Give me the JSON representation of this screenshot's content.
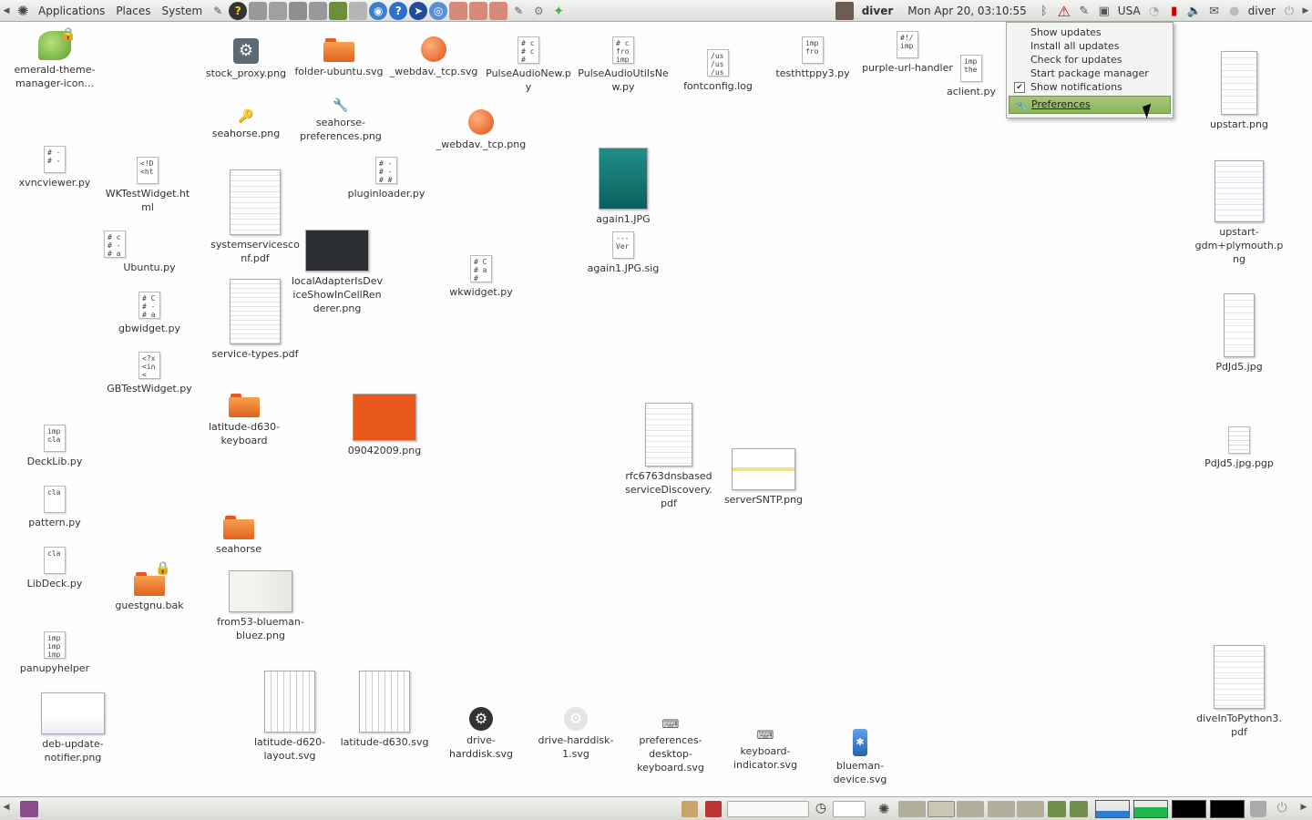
{
  "top_panel": {
    "menu": [
      "Applications",
      "Places",
      "System"
    ],
    "user": "diver",
    "clock": "Mon Apr 20, 03:10:55",
    "keyboard_layout": "USA",
    "chat_user": "diver"
  },
  "update_menu": {
    "items": [
      "Show updates",
      "Install all updates",
      "Check for updates",
      "Start package manager"
    ],
    "check_item": "Show notifications",
    "check_mark": "✔",
    "selected": "Preferences"
  },
  "desktop_icons": [
    {
      "label": "emerald-theme-manager-icon...",
      "glyph": "🍃"
    },
    {
      "label": "xvncviewer.py",
      "glyph": "# -\n# -"
    },
    {
      "label": "WKTestWidget.html",
      "glyph": "<!D\n<ht"
    },
    {
      "label": "Ubuntu.py",
      "glyph": "# c\n# -\n# a"
    },
    {
      "label": "gbwidget.py",
      "glyph": "# C\n# -\n# a"
    },
    {
      "label": "GBTestWidget.py",
      "glyph": "<?x\n<in\n<"
    },
    {
      "label": "DeckLib.py",
      "glyph": "imp\ncla"
    },
    {
      "label": "pattern.py",
      "glyph": "cla"
    },
    {
      "label": "LibDeck.py",
      "glyph": "cla"
    },
    {
      "label": "guestgnu.bak",
      "glyph": ""
    },
    {
      "label": "panupyhelper",
      "glyph": "imp\nimp\nimp"
    },
    {
      "label": "deb-update-notifier.png",
      "glyph": ""
    },
    {
      "label": "stock_proxy.png",
      "glyph": "⚙"
    },
    {
      "label": "seahorse.png",
      "glyph": "🔑"
    },
    {
      "label": "systemservicesconf.pdf",
      "glyph": ""
    },
    {
      "label": "service-types.pdf",
      "glyph": ""
    },
    {
      "label": "latitude-d630-keyboard",
      "glyph": ""
    },
    {
      "label": "seahorse",
      "glyph": ""
    },
    {
      "label": "from53-blueman-bluez.png",
      "glyph": ""
    },
    {
      "label": "latitude-d620-layout.svg",
      "glyph": ""
    },
    {
      "label": "folder-ubuntu.svg",
      "glyph": ""
    },
    {
      "label": "seahorse-preferences.png",
      "glyph": "🔧"
    },
    {
      "label": "localAdapterIsDeviceShowInCellRenderer.png",
      "glyph": ""
    },
    {
      "label": "latitude-d630.svg",
      "glyph": ""
    },
    {
      "label": "_webdav._tcp.svg",
      "glyph": ""
    },
    {
      "label": "pluginloader.py",
      "glyph": "# -\n# -\n# #"
    },
    {
      "label": "_webdav._tcp.png",
      "glyph": ""
    },
    {
      "label": "09042009.png",
      "glyph": ""
    },
    {
      "label": "wkwidget.py",
      "glyph": "# C\n# a\n#"
    },
    {
      "label": "drive-harddisk.svg",
      "glyph": "⚙"
    },
    {
      "label": "PulseAudioNew.py",
      "glyph": "# c\n# c\n#"
    },
    {
      "label": "drive-harddisk-1.svg",
      "glyph": "⚙"
    },
    {
      "label": "PulseAudioUtilsNew.py",
      "glyph": "# c\nfro\nimp"
    },
    {
      "label": "again1.JPG",
      "glyph": ""
    },
    {
      "label": "again1.JPG.sig",
      "glyph": "---\nVer"
    },
    {
      "label": "rfc6763dnsbasedserviceDiscovery.pdf",
      "glyph": ""
    },
    {
      "label": "preferences-desktop-keyboard.svg",
      "glyph": "⌨"
    },
    {
      "label": "fontconfig.log",
      "glyph": "/us\n/us\n/us"
    },
    {
      "label": "serverSNTP.png",
      "glyph": ""
    },
    {
      "label": "keyboard-indicator.svg",
      "glyph": "⌨"
    },
    {
      "label": "testhttppy3.py",
      "glyph": "imp\nfro"
    },
    {
      "label": "blueman-device.svg",
      "glyph": "✱"
    },
    {
      "label": "purple-url-handler",
      "glyph": "#!/\nimp"
    },
    {
      "label": "aclient.py",
      "glyph": "imp\nthe"
    },
    {
      "label": "upstart.png",
      "glyph": ""
    },
    {
      "label": "upstart-gdm+plymouth.png",
      "glyph": ""
    },
    {
      "label": "PdJd5.jpg",
      "glyph": ""
    },
    {
      "label": "PdJd5.jpg.pgp",
      "glyph": ""
    },
    {
      "label": "diveInToPython3.pdf",
      "glyph": ""
    }
  ],
  "colors": {
    "panel": "#dcdcd9",
    "folder": "#e9591f",
    "menu_highlight": "#8bb35c",
    "alert": "#cc0000"
  }
}
